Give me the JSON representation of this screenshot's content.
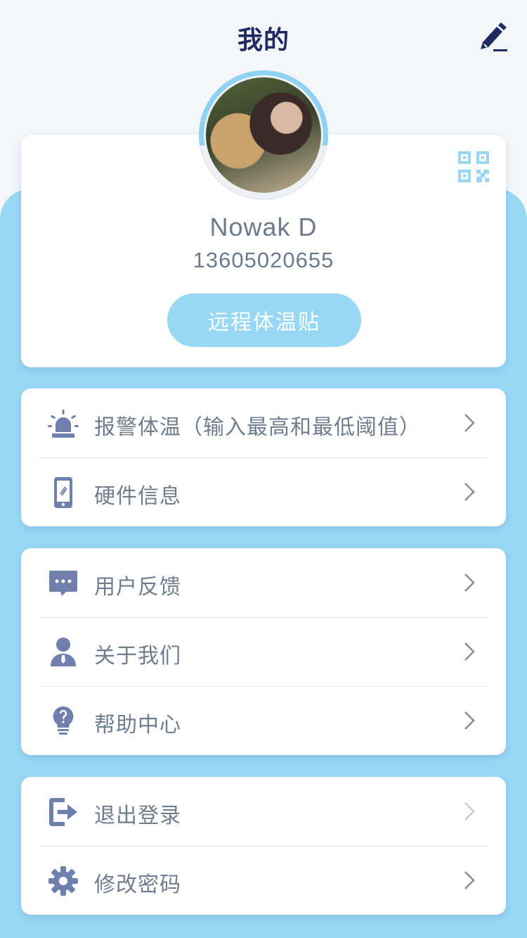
{
  "header": {
    "title": "我的"
  },
  "profile": {
    "name": "Nowak D",
    "phone": "13605020655",
    "button_label": "远程体温贴"
  },
  "menu_groups": [
    {
      "items": [
        {
          "label": "报警体温（输入最高和最低阈值）",
          "icon": "alarm-icon"
        },
        {
          "label": "硬件信息",
          "icon": "device-icon"
        }
      ]
    },
    {
      "items": [
        {
          "label": "用户反馈",
          "icon": "chat-icon"
        },
        {
          "label": "关于我们",
          "icon": "user-icon"
        },
        {
          "label": "帮助中心",
          "icon": "lightbulb-icon"
        }
      ]
    },
    {
      "items": [
        {
          "label": "退出登录",
          "icon": "logout-icon"
        },
        {
          "label": "修改密码",
          "icon": "gear-icon"
        }
      ]
    }
  ],
  "colors": {
    "accent": "#98d8f5",
    "icon": "#6f7fae",
    "title": "#1f2a62",
    "text": "#6f7d8e"
  }
}
